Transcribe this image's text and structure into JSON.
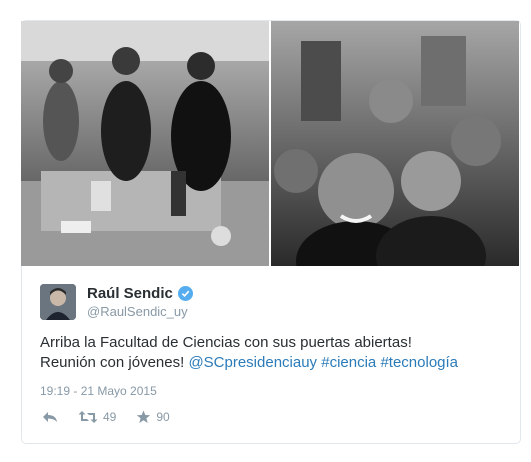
{
  "tweet": {
    "author": {
      "display_name": "Raúl Sendic",
      "handle": "@RaulSendic_uy",
      "verified": true
    },
    "text": {
      "line1": "Arriba la Facultad de Ciencias con sus puertas abiertas!",
      "line2_prefix": "Reunión con jóvenes! ",
      "mention": "@SCpresidenciauy",
      "hashtag1": "#ciencia",
      "hashtag2": "#tecnología"
    },
    "timestamp": "19:19 - 21 Mayo 2015",
    "actions": {
      "reply_icon": "reply-icon",
      "retweet_icon": "retweet-icon",
      "retweet_count": "49",
      "favorite_icon": "star-icon",
      "favorite_count": "90"
    },
    "photos": [
      "lab-visit-photo",
      "group-selfie-photo"
    ]
  },
  "colors": {
    "link": "#2b7bb9",
    "meta": "#8899a6",
    "text": "#292f33",
    "verified": "#55acee",
    "border": "#e1e8ed"
  }
}
